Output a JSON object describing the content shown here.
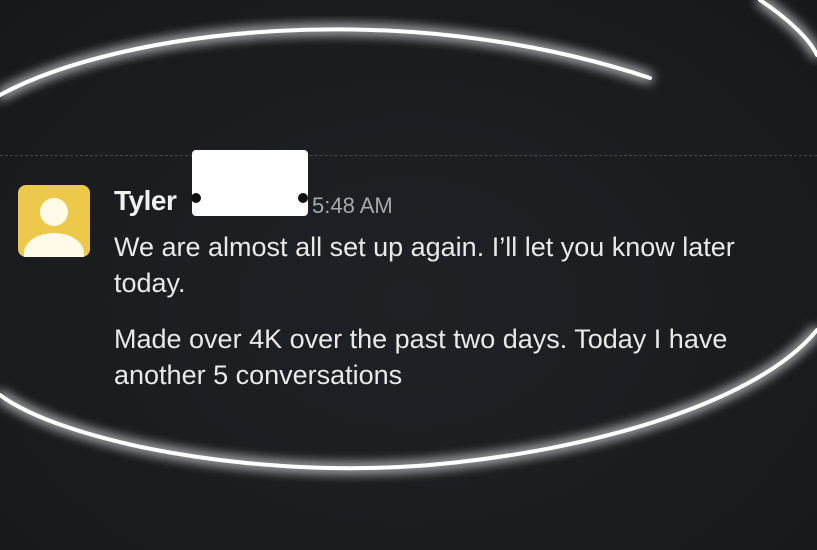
{
  "message": {
    "sender": "Tyler",
    "timestamp": "5:48 AM",
    "paragraphs": [
      "We are almost all set up again. I’ll let you know later today.",
      "Made over 4K over the past two days. Today I have another 5 conversations"
    ]
  },
  "icons": {
    "avatar": "user-avatar-icon"
  },
  "colors": {
    "background": "#1b1d21",
    "avatar": "#ecc94b",
    "text": "#e9e9ea",
    "timestamp": "#a7a9ad",
    "highlight_ring": "#ffffff"
  }
}
